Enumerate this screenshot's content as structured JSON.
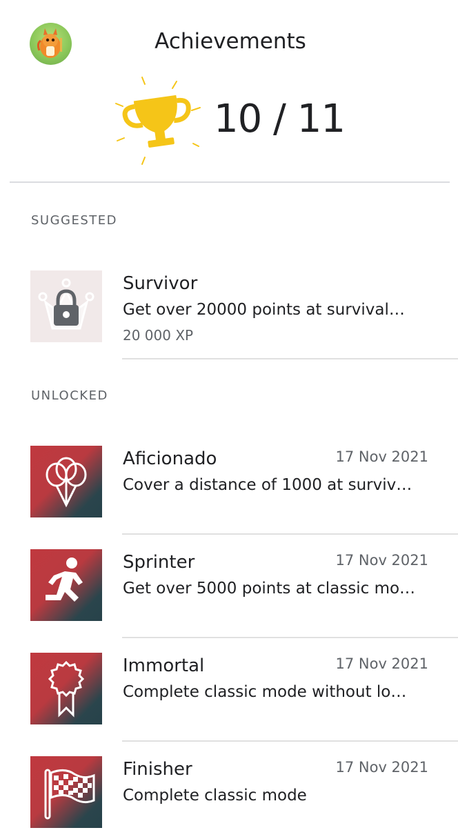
{
  "header": {
    "title": "Achievements",
    "count": "10 / 11"
  },
  "sections": {
    "suggested_label": "SUGGESTED",
    "unlocked_label": "UNLOCKED"
  },
  "suggested": [
    {
      "name": "Survivor",
      "description": "Get over 20000 points at survival…",
      "xp": "20 000 XP",
      "icon": "lock-icon"
    }
  ],
  "unlocked": [
    {
      "name": "Aficionado",
      "description": "Cover a distance of 1000 at surviv…",
      "date": "17 Nov 2021",
      "icon": "balloons-icon"
    },
    {
      "name": "Sprinter",
      "description": "Get over 5000 points at classic mo…",
      "date": "17 Nov 2021",
      "icon": "running-person-icon"
    },
    {
      "name": "Immortal",
      "description": "Complete classic mode without lo…",
      "date": "17 Nov 2021",
      "icon": "ribbon-badge-icon"
    },
    {
      "name": "Finisher",
      "description": "Complete classic mode",
      "date": "17 Nov 2021",
      "icon": "checkered-flag-icon"
    }
  ],
  "colors": {
    "icon_red": "#c0393f",
    "icon_teal": "#27424a",
    "trophy_gold": "#f5c518",
    "divider": "#dadce0"
  }
}
